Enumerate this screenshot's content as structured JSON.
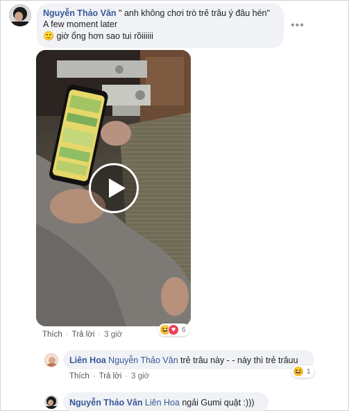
{
  "comment1": {
    "author": "Nguyễn Thảo Vân",
    "line1": " \" anh không chơi trò trẻ trâu ý đâu hén\"",
    "line2": "A few moment later",
    "emoji": "🙂",
    "line3": "giờ ổng hơn sao tui rồiiiiii",
    "more_label": "•••",
    "actions": {
      "like": "Thích",
      "reply": "Trả lời",
      "time": "3 giờ",
      "dot": "·"
    },
    "reactions": {
      "types": [
        "haha-icon",
        "love-icon"
      ],
      "count": "6"
    }
  },
  "reply1": {
    "author": "Liên Hoa",
    "mention": "Nguyễn Thảo Vân",
    "text": "trẻ trâu này - - này thì trẻ trâuu",
    "actions": {
      "like": "Thích",
      "reply": "Trả lời",
      "time": "3 giờ",
      "dot": "·"
    },
    "reactions": {
      "types": [
        "haha-icon"
      ],
      "count": "1"
    }
  },
  "reply2": {
    "author": "Nguyễn Thảo Vân",
    "mention": "Liên Hoa",
    "text": "ngải Gumi quật :)))"
  },
  "colors": {
    "name": "#385898",
    "bubble": "#f0f2f5",
    "meta": "#616770"
  }
}
